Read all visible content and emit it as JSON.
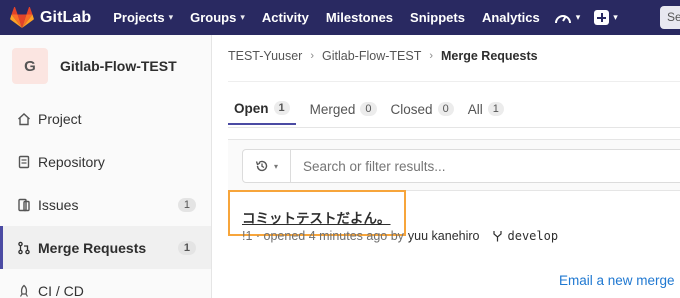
{
  "navbar": {
    "brand": "GitLab",
    "items": [
      {
        "label": "Projects",
        "has_caret": true
      },
      {
        "label": "Groups",
        "has_caret": true
      },
      {
        "label": "Activity",
        "has_caret": false
      },
      {
        "label": "Milestones",
        "has_caret": false
      },
      {
        "label": "Snippets",
        "has_caret": false
      },
      {
        "label": "Analytics",
        "has_caret": false
      }
    ],
    "search_placeholder": "Se",
    "caret": "▾"
  },
  "sidebar": {
    "project_initial": "G",
    "project_name": "Gitlab-Flow-TEST",
    "items": [
      {
        "label": "Project",
        "icon": "home-icon",
        "badge": ""
      },
      {
        "label": "Repository",
        "icon": "doc-icon",
        "badge": ""
      },
      {
        "label": "Issues",
        "icon": "issues-icon",
        "badge": "1"
      },
      {
        "label": "Merge Requests",
        "icon": "merge-request-icon",
        "badge": "1",
        "active": true
      },
      {
        "label": "CI / CD",
        "icon": "rocket-icon",
        "badge": ""
      }
    ]
  },
  "breadcrumb": {
    "items": [
      "TEST-Yuuser",
      "Gitlab-Flow-TEST",
      "Merge Requests"
    ]
  },
  "tabs": [
    {
      "label": "Open",
      "count": "1",
      "active": true
    },
    {
      "label": "Merged",
      "count": "0"
    },
    {
      "label": "Closed",
      "count": "0"
    },
    {
      "label": "All",
      "count": "1"
    }
  ],
  "filter": {
    "placeholder": "Search or filter results..."
  },
  "merge_request": {
    "title": "コミットテストだよん。",
    "meta": "!1 · opened 4 minutes ago by",
    "author": "yuu kanehiro",
    "branch": "develop"
  },
  "footer": {
    "email_link": "Email a new merge"
  },
  "colors": {
    "navbar": "#292961",
    "active_accent": "#4b4ba3",
    "highlight_box": "#f7a53b",
    "link": "#1f78d1"
  }
}
